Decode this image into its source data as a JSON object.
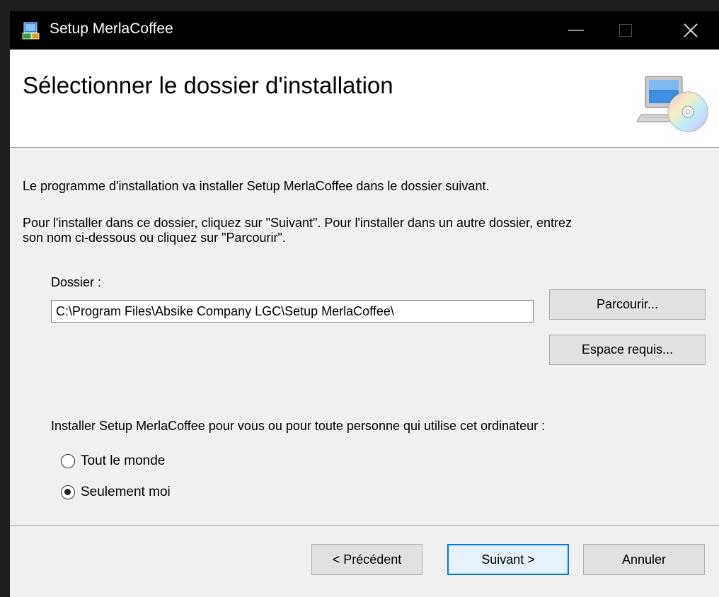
{
  "window": {
    "title": "Setup MerlaCoffee"
  },
  "header": {
    "title": "Sélectionner le dossier d'installation"
  },
  "body": {
    "intro": "Le programme d'installation va installer Setup MerlaCoffee dans le dossier suivant.",
    "instructions_line1": "Pour l'installer dans ce dossier, cliquez sur \"Suivant\". Pour l'installer dans un autre dossier, entrez",
    "instructions_line2": "son nom ci-dessous ou cliquez sur \"Parcourir\".",
    "folder_label": "Dossier :",
    "folder_path": "C:\\Program Files\\Absike Company LGC\\Setup MerlaCoffee\\",
    "browse_button": "Parcourir...",
    "space_button": "Espace requis...",
    "install_for_question": "Installer Setup MerlaCoffee pour vous ou pour toute personne qui utilise cet ordinateur :",
    "radio_everyone": "Tout le monde",
    "radio_only_me": "Seulement moi",
    "selected_option": "Seulement moi"
  },
  "footer": {
    "previous_button": "< Précédent",
    "next_button": "Suivant >",
    "cancel_button": "Annuler"
  },
  "colors": {
    "titlebar": "#000000",
    "accent": "#0078d7",
    "dialog_bg": "#f0f0f0"
  },
  "icons": {
    "app": "installer-icon",
    "minimize": "minimize-icon",
    "maximize": "maximize-icon",
    "close": "close-icon",
    "header_graphic": "computer-cd-icon"
  }
}
